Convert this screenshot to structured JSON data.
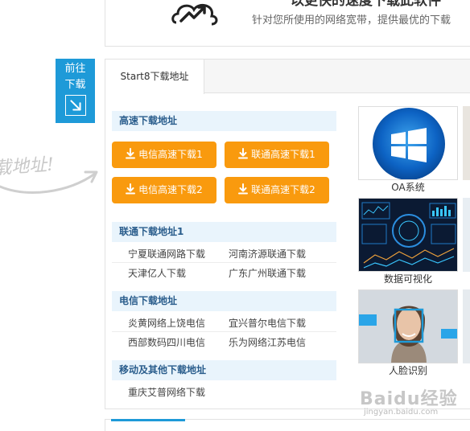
{
  "banner": {
    "heading": "以更快的速度下载此软件",
    "subtext": "针对您所使用的网络宽带，提供最优的下载"
  },
  "side_tab": {
    "line1": "前往",
    "line2": "下载"
  },
  "scribble": "载地址!",
  "tab": {
    "label": "Start8下载地址"
  },
  "fast": {
    "heading": "高速下载地址",
    "buttons": [
      "电信高速下载1",
      "联通高速下载1",
      "电信高速下载2",
      "联通高速下载2"
    ]
  },
  "unicom": {
    "heading": "联通下载地址1",
    "links": [
      "宁夏联通网路下载",
      "河南济源联通下载",
      "天津亿人下载",
      "广东广州联通下载"
    ]
  },
  "telecom": {
    "heading": "电信下载地址",
    "links": [
      "炎黄网络上饶电信",
      "宜兴普尔电信下载",
      "西部数码四川电信",
      "乐为网络江苏电信"
    ]
  },
  "mobile": {
    "heading": "移动及其他下载地址",
    "links": [
      "重庆艾普网络下载"
    ]
  },
  "thumbs": [
    {
      "caption": "OA系统",
      "icon": "windows-logo"
    },
    {
      "caption": "数据可视化",
      "icon": "dashboard-image"
    },
    {
      "caption": "人脸识别",
      "icon": "face-recognition-image"
    }
  ],
  "watermark": {
    "main": "Baidu经验",
    "sub": "jingyan.baidu.com"
  },
  "colors": {
    "accent": "#1e9ad8",
    "button": "#f99a0e",
    "section_bg": "#e9f4fc",
    "section_text": "#2a5d8c"
  }
}
